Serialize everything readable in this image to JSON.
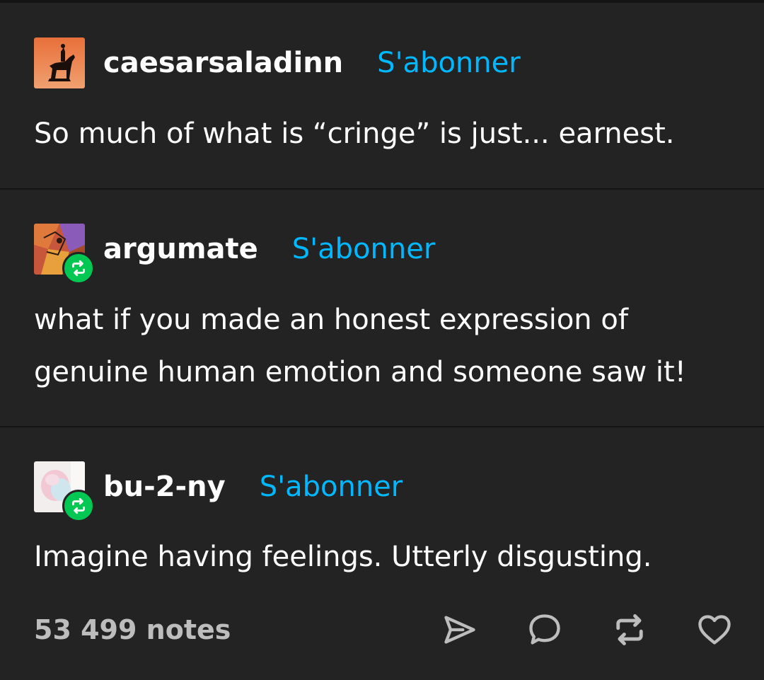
{
  "posts": [
    {
      "username": "caesarsaladinn",
      "follow_label": "S'abonner",
      "avatar_icon": "horse-statue-avatar",
      "reblog": false,
      "text_lines": [
        "So much of what is “cringe” is just... earnest."
      ]
    },
    {
      "username": "argumate",
      "follow_label": "S'abonner",
      "avatar_icon": "abstract-face-avatar",
      "reblog": true,
      "text_lines": [
        "what if you made an honest expression of",
        "genuine human emotion and someone saw it!"
      ]
    },
    {
      "username": "bu-2-ny",
      "follow_label": "S'abonner",
      "avatar_icon": "pastel-portrait-avatar",
      "reblog": true,
      "text_lines": [
        "Imagine having feelings. Utterly disgusting."
      ]
    }
  ],
  "footer": {
    "notes": "53 499 notes",
    "actions": [
      "share-icon",
      "comment-icon",
      "reblog-icon",
      "like-heart-icon"
    ]
  },
  "colors": {
    "background": "#232323",
    "divider": "#141414",
    "accent_follow": "#00b8ff",
    "reblog_badge": "#00c853",
    "text": "#ffffff",
    "muted": "#bdbdbd"
  }
}
